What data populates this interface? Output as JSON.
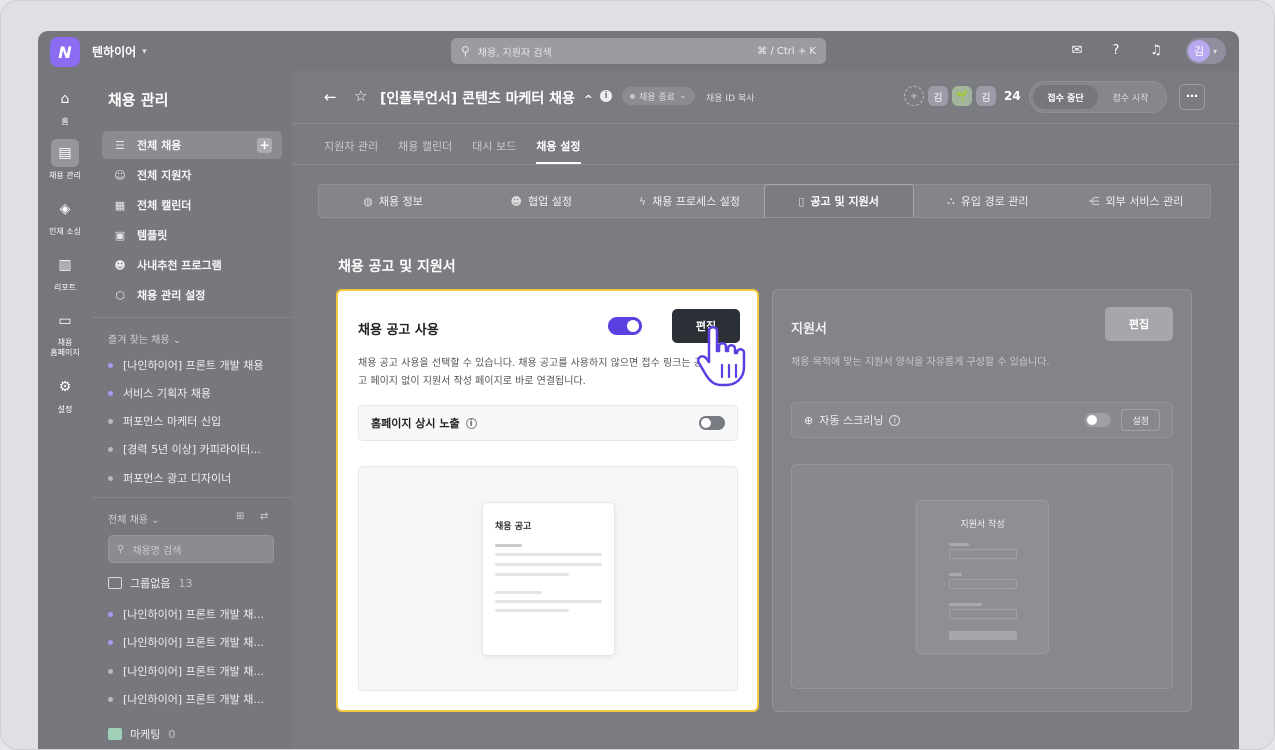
{
  "topbar": {
    "workspace": "텐하이어",
    "logo_letter": "N",
    "search_placeholder": "채용, 지원자 검색",
    "search_shortcut": "⌘ / Ctrl + K",
    "avatar": "김",
    "icons": [
      "chat-icon",
      "help-icon",
      "bell-icon"
    ]
  },
  "rail": {
    "items": [
      {
        "label": "홈",
        "icon": "home-icon"
      },
      {
        "label": "채용 관리",
        "icon": "jobs-icon",
        "active": true
      },
      {
        "label": "인재 소싱",
        "icon": "layers-icon"
      },
      {
        "label": "리포트",
        "icon": "chart-icon"
      },
      {
        "label": "채용\n홈페이지",
        "icon": "monitor-icon"
      },
      {
        "label": "설정",
        "icon": "gear-icon"
      }
    ]
  },
  "sidebar": {
    "title": "채용 관리",
    "menu": [
      "전체 채용",
      "전체 지원자",
      "전체 캘린더",
      "템플릿",
      "사내추천 프로그램",
      "채용 관리 설정"
    ],
    "favorites_label": "즐겨 찾는 채용",
    "favorites": [
      {
        "label": "[나인하이어] 프론트 개발 채용",
        "color": "#a89cf0"
      },
      {
        "label": "서비스 기획자 채용",
        "color": "#a89cf0"
      },
      {
        "label": "퍼포먼스 마케터 신입",
        "color": "#b8b9bc"
      },
      {
        "label": "[경력 5년 이상] 카피라이터...",
        "color": "#b8b9bc"
      },
      {
        "label": "퍼포먼스 광고 디자이너",
        "color": "#b8b9bc"
      }
    ],
    "all_jobs_label": "전체 채용",
    "search_placeholder": "채용명 검색",
    "group_none": {
      "label": "그룹없음",
      "count": "13"
    },
    "group_items": [
      {
        "label": "[나인하이어] 프론트 개발 채...",
        "color": "#a89cf0"
      },
      {
        "label": "[나인하이어] 프론트 개발 채...",
        "color": "#a89cf0"
      },
      {
        "label": "[나인하이어] 프론트 개발 채...",
        "color": "#b8b9bc"
      },
      {
        "label": "[나인하이어] 프론트 개발 채...",
        "color": "#b8b9bc"
      }
    ],
    "group_marketing": {
      "label": "마케팅",
      "count": "0"
    }
  },
  "header": {
    "title": "[인플루언서] 콘텐츠 마케터 채용",
    "status": "채용 종료",
    "copy_id": "채용 ID 복사",
    "members": [
      "김",
      "🌱",
      "김"
    ],
    "member_count": "24",
    "recv_stop": "접수 중단",
    "recv_start": "접수 시작"
  },
  "subtabs": [
    "지원자 관리",
    "채용 캘린더",
    "대시 보드",
    "채용 설정"
  ],
  "settings_tabs": [
    {
      "label": "채용 정보",
      "icon": "globe-icon"
    },
    {
      "label": "협업 설정",
      "icon": "users-icon"
    },
    {
      "label": "채용 프로세스 설정",
      "icon": "bolt-icon"
    },
    {
      "label": "공고 및 지원서",
      "icon": "doc-icon",
      "active": true
    },
    {
      "label": "유입 경로 관리",
      "icon": "flow-icon"
    },
    {
      "label": "외부 서비스 관리",
      "icon": "share-icon"
    }
  ],
  "section_title": "채용 공고 및 지원서",
  "posting_card": {
    "title": "채용 공고 사용",
    "enabled": true,
    "edit": "편집",
    "desc": "채용 공고 사용을 선택할 수 있습니다. 채용 공고를 사용하지 않으면 접수 링크는 공고 페이지 없이 지원서 작성 페이지로 바로 연결됩니다.",
    "option": "홈페이지 상시 노출",
    "option_enabled": false,
    "preview_title": "채용 공고"
  },
  "form_card": {
    "title": "지원서",
    "edit": "편집",
    "desc": "채용 목적에 맞는 지원서 양식을 자유롭게 구성할 수 있습니다.",
    "option": "자동 스크리닝",
    "option_setting": "설정",
    "preview_title": "지원서 작성"
  },
  "colors": {
    "accent": "#5b3fe0",
    "highlight": "#f4c93b",
    "overlay": "#75777d"
  }
}
